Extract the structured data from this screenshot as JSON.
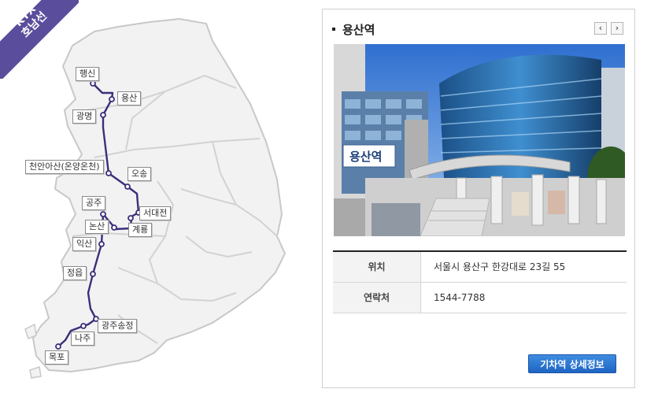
{
  "line": {
    "badge_line1": "KTX",
    "badge_line2": "호남선",
    "line_color": "#3a2f7a",
    "stations": [
      {
        "name": "행신"
      },
      {
        "name": "용산"
      },
      {
        "name": "광명"
      },
      {
        "name": "천안아산(온양온천)"
      },
      {
        "name": "오송"
      },
      {
        "name": "공주"
      },
      {
        "name": "서대전"
      },
      {
        "name": "논산"
      },
      {
        "name": "계룡"
      },
      {
        "name": "익산"
      },
      {
        "name": "정읍"
      },
      {
        "name": "광주송정"
      },
      {
        "name": "나주"
      },
      {
        "name": "목포"
      }
    ]
  },
  "station_info": {
    "title": "용산역",
    "prev_icon": "‹",
    "next_icon": "›",
    "sign_text": "용산역",
    "rows": [
      {
        "key": "위치",
        "value": "서울시 용산구 한강대로 23길 55"
      },
      {
        "key": "연락처",
        "value": "1544-7788"
      }
    ],
    "detail_button": "기차역 상세정보"
  }
}
